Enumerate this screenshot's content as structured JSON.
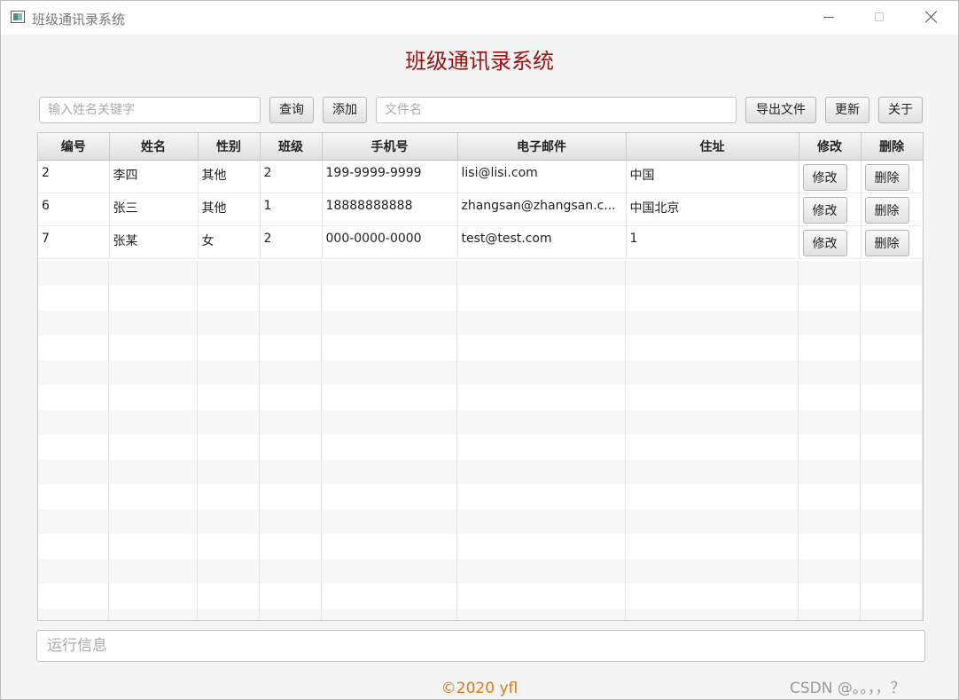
{
  "window": {
    "title": "班级通讯录系统",
    "icon": "app-window-icon",
    "controls": {
      "minimize": "minimize-icon",
      "maximize": "maximize-icon",
      "close": "close-icon"
    }
  },
  "header": {
    "title": "班级通讯录系统",
    "color": "#a01010"
  },
  "toolbar": {
    "search_placeholder": "输入姓名关键字",
    "search_value": "",
    "query_label": "查询",
    "add_label": "添加",
    "filename_placeholder": "文件名",
    "filename_value": "",
    "export_label": "导出文件",
    "update_label": "更新",
    "about_label": "关于"
  },
  "table": {
    "columns": [
      "编号",
      "姓名",
      "性别",
      "班级",
      "手机号",
      "电子邮件",
      "住址",
      "修改",
      "删除"
    ],
    "rows": [
      {
        "id": "2",
        "name": "李四",
        "gender": "其他",
        "class": "2",
        "phone": "199-9999-9999",
        "email": "lisi@lisi.com",
        "address": "中国",
        "edit": "修改",
        "delete": "删除"
      },
      {
        "id": "6",
        "name": "张三",
        "gender": "其他",
        "class": "1",
        "phone": "18888888888",
        "email": "zhangsan@zhangsan.c...",
        "address": "中国北京",
        "edit": "修改",
        "delete": "删除"
      },
      {
        "id": "7",
        "name": "张某",
        "gender": "女",
        "class": "2",
        "phone": "000-0000-0000",
        "email": "test@test.com",
        "address": "1",
        "edit": "修改",
        "delete": "删除"
      }
    ]
  },
  "status": {
    "placeholder": "运行信息",
    "value": ""
  },
  "footer": {
    "copyright": "©2020 yfl",
    "watermark": "CSDN @。。，，？"
  }
}
